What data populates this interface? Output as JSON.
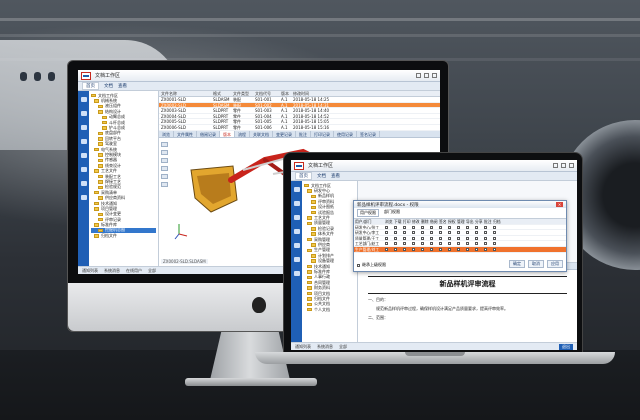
{
  "imac_app": {
    "title": "文档工作区",
    "toolbar": [
      "首页",
      "文档",
      "查看"
    ],
    "tree_nodes": [
      {
        "label": "文档工作区",
        "level": 0
      },
      {
        "label": "机械系统",
        "level": 1
      },
      {
        "label": "液压组件",
        "level": 2
      },
      {
        "label": "结构设计",
        "level": 2
      },
      {
        "label": "动臂总成",
        "level": 3
      },
      {
        "label": "斗杆总成",
        "level": 3
      },
      {
        "label": "铲斗总成",
        "level": 3
      },
      {
        "label": "底盘部件",
        "level": 2
      },
      {
        "label": "回转平台",
        "level": 2
      },
      {
        "label": "驾驶室",
        "level": 2
      },
      {
        "label": "电气系统",
        "level": 1
      },
      {
        "label": "控制模块",
        "level": 2
      },
      {
        "label": "传感器",
        "level": 2
      },
      {
        "label": "线束设计",
        "level": 2
      },
      {
        "label": "工艺文件",
        "level": 1
      },
      {
        "label": "装配工艺",
        "level": 2
      },
      {
        "label": "焊接工艺",
        "level": 2
      },
      {
        "label": "检验规范",
        "level": 2
      },
      {
        "label": "采购清单",
        "level": 1
      },
      {
        "label": "供应商资料",
        "level": 2
      },
      {
        "label": "技术通知",
        "level": 1
      },
      {
        "label": "项目管理",
        "level": 1
      },
      {
        "label": "设计变更",
        "level": 2
      },
      {
        "label": "评审记录",
        "level": 2
      },
      {
        "label": "标准件库",
        "level": 1
      },
      {
        "label": "挖掘机总图",
        "level": 2,
        "selected": true
      },
      {
        "label": "归档文件",
        "level": 1
      }
    ],
    "columns": [
      "文件名称",
      "格式",
      "文件类型",
      "文档代号",
      "版本",
      "修改时间"
    ],
    "rows": [
      [
        "ZX0001-SLD",
        "SLDASM",
        "装配",
        "S01-001",
        "A.1",
        "2018-05-18 14:25"
      ],
      [
        "ZX0002-SLD",
        "SLDASM",
        "装配",
        "S01-002",
        "A.1",
        "2018-05-18 14:31"
      ],
      [
        "ZX0003-SLD",
        "SLDPRT",
        "零件",
        "S01-003",
        "A.1",
        "2018-05-18 14:40"
      ],
      [
        "ZX0004-SLD",
        "SLDPRT",
        "零件",
        "S01-004",
        "A.1",
        "2018-05-18 14:52"
      ],
      [
        "ZX0005-SLD",
        "SLDPRT",
        "零件",
        "S01-005",
        "A.1",
        "2018-05-18 15:05"
      ],
      [
        "ZX0006-SLD",
        "SLDPRT",
        "零件",
        "S01-006",
        "A.1",
        "2018-05-18 15:16"
      ]
    ],
    "highlight_row": 1,
    "tabs": [
      "浏览",
      "文件属性",
      "借阅记录",
      "版本",
      "流程",
      "关联文档",
      "变更记录",
      "批注",
      "打印记录",
      "使用记录",
      "签名记录"
    ],
    "active_tab": 3,
    "filename_bar": "ZX0002-SLD.SLDASM",
    "status": [
      "通知列表",
      "系统消息",
      "在线用户",
      "全部"
    ]
  },
  "laptop_app": {
    "title": "文档工作区",
    "toolbar": [
      "首页",
      "文档",
      "查看"
    ],
    "tree_nodes": [
      {
        "label": "文档工作区",
        "level": 0
      },
      {
        "label": "研发中心",
        "level": 1
      },
      {
        "label": "新品样机",
        "level": 2
      },
      {
        "label": "评审资料",
        "level": 2
      },
      {
        "label": "设计图纸",
        "level": 2
      },
      {
        "label": "试验报告",
        "level": 2
      },
      {
        "label": "工艺文件",
        "level": 1
      },
      {
        "label": "质量管理",
        "level": 1
      },
      {
        "label": "检验记录",
        "level": 2
      },
      {
        "label": "体系文件",
        "level": 2
      },
      {
        "label": "采购管理",
        "level": 1
      },
      {
        "label": "供应商",
        "level": 2
      },
      {
        "label": "生产管理",
        "level": 1
      },
      {
        "label": "计划排产",
        "level": 2
      },
      {
        "label": "设备管理",
        "level": 2
      },
      {
        "label": "技术通知",
        "level": 1
      },
      {
        "label": "标准件库",
        "level": 1
      },
      {
        "label": "人事行政",
        "level": 1
      },
      {
        "label": "合同管理",
        "level": 1
      },
      {
        "label": "财务资料",
        "level": 1
      },
      {
        "label": "项目文档",
        "level": 1
      },
      {
        "label": "归档文件",
        "level": 1
      },
      {
        "label": "公共文档",
        "level": 1
      },
      {
        "label": "个人文档",
        "level": 1
      }
    ],
    "dialog": {
      "title": "新品样机评审流程.docx - 权限",
      "tabs": [
        "用户权限",
        "部门权限"
      ],
      "columns": [
        "用户/部门",
        "浏览",
        "下载",
        "打印",
        "修改",
        "删除",
        "借阅",
        "签名",
        "授权",
        "管理",
        "导出",
        "分享",
        "批注",
        "归档"
      ],
      "rows": [
        "研发中心/张工",
        "研发中心/李工",
        "质量管理/王工",
        "工艺部门/赵工",
        "生产管理/刘工"
      ],
      "highlight_row": 4,
      "footer_label": "继承上级权限",
      "buttons": [
        "确定",
        "取消",
        "应用"
      ]
    },
    "document": {
      "heading": "新品样机评审流程",
      "section1": "一、目的：",
      "para1": "规范新品样机评审过程，确保样机设计满足产品质量要求，提高评审效率。",
      "section2": "二、范围："
    },
    "status": [
      "通知列表",
      "系统消息",
      "全部"
    ],
    "status_right": "退出"
  },
  "colors": {
    "nav_blue": "#1f5fb5",
    "highlight_orange": "#f0722d",
    "logo_red": "#c7291f"
  },
  "icons": [
    "apple-logo-icon",
    "folder-icon",
    "window-close-icon",
    "window-minimize-icon",
    "window-maximize-icon"
  ]
}
